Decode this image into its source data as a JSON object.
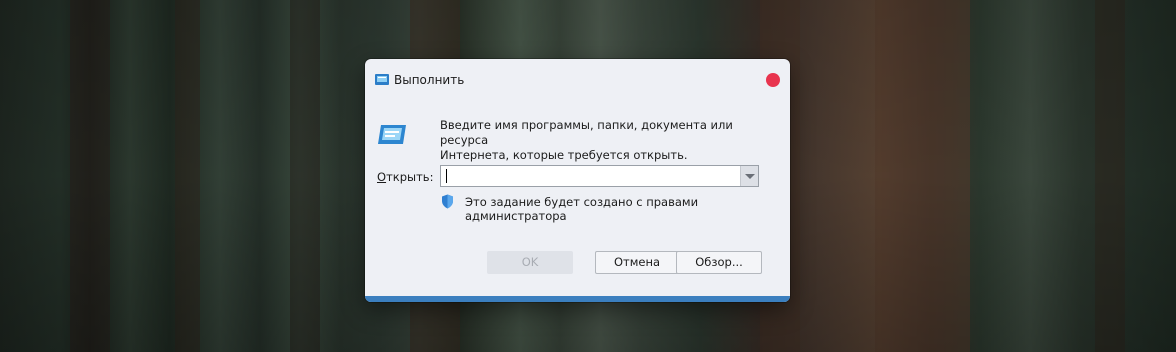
{
  "dialog": {
    "title": "Выполнить",
    "description_line1": "Введите имя программы, папки, документа или ресурса",
    "description_line2": "Интернета, которые требуется открыть.",
    "open_label_underlined": "О",
    "open_label_rest": "ткрыть:",
    "open_value": "",
    "admin_note": "Это задание будет создано с правами администратора",
    "buttons": {
      "ok": "OK",
      "cancel": "Отмена",
      "browse": "Обзор..."
    }
  },
  "icons": {
    "title": "run-icon",
    "large": "run-icon",
    "shield": "shield-icon",
    "close": "close-icon",
    "dropdown": "chevron-down-icon"
  },
  "colors": {
    "accent": "#3b7fbf",
    "close": "#e8344e",
    "dialog_bg": "#eef0f5"
  }
}
